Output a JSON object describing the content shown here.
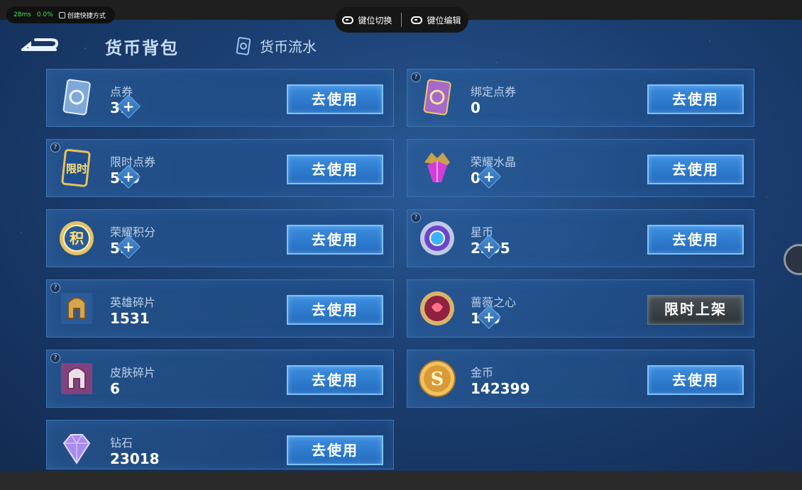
{
  "overlay": {
    "ping": "28ms",
    "loss": "0.0%",
    "shortcut_label": "创建快捷方式",
    "key_switch": "键位切换",
    "key_edit": "键位编辑"
  },
  "header": {
    "title": "货币背包",
    "flow_tab": "货币流水"
  },
  "currencies": [
    {
      "name": "点券",
      "value": "31",
      "button": "去使用",
      "plus": true,
      "help": false,
      "icon": "ticket-icon"
    },
    {
      "name": "绑定点券",
      "value": "0",
      "button": "去使用",
      "plus": false,
      "help": true,
      "icon": "bound-ticket-icon"
    },
    {
      "name": "限时点券",
      "value": "590",
      "button": "去使用",
      "plus": true,
      "help": true,
      "icon": "limited-ticket-icon",
      "icon_text": "限时"
    },
    {
      "name": "荣耀水晶",
      "value": "0",
      "button": "去使用",
      "plus": true,
      "help": false,
      "icon": "glory-crystal-icon"
    },
    {
      "name": "荣耀积分",
      "value": "55",
      "button": "去使用",
      "plus": true,
      "help": false,
      "icon": "glory-points-icon",
      "icon_text": "积"
    },
    {
      "name": "星币",
      "value": "2395",
      "button": "去使用",
      "plus": true,
      "help": true,
      "icon": "star-coin-icon"
    },
    {
      "name": "英雄碎片",
      "value": "1531",
      "button": "去使用",
      "plus": false,
      "help": true,
      "icon": "hero-fragment-icon"
    },
    {
      "name": "蔷薇之心",
      "value": "100",
      "button": "限时上架",
      "plus": true,
      "help": false,
      "icon": "rose-heart-icon"
    },
    {
      "name": "皮肤碎片",
      "value": "6",
      "button": "去使用",
      "plus": false,
      "help": true,
      "icon": "skin-fragment-icon"
    },
    {
      "name": "金币",
      "value": "142399",
      "button": "去使用",
      "plus": false,
      "help": false,
      "icon": "gold-coin-icon",
      "icon_text": "S"
    },
    {
      "name": "钻石",
      "value": "23018",
      "button": "去使用",
      "plus": false,
      "help": false,
      "icon": "diamond-icon"
    }
  ],
  "help_glyph": "?",
  "plus_glyph": "+"
}
